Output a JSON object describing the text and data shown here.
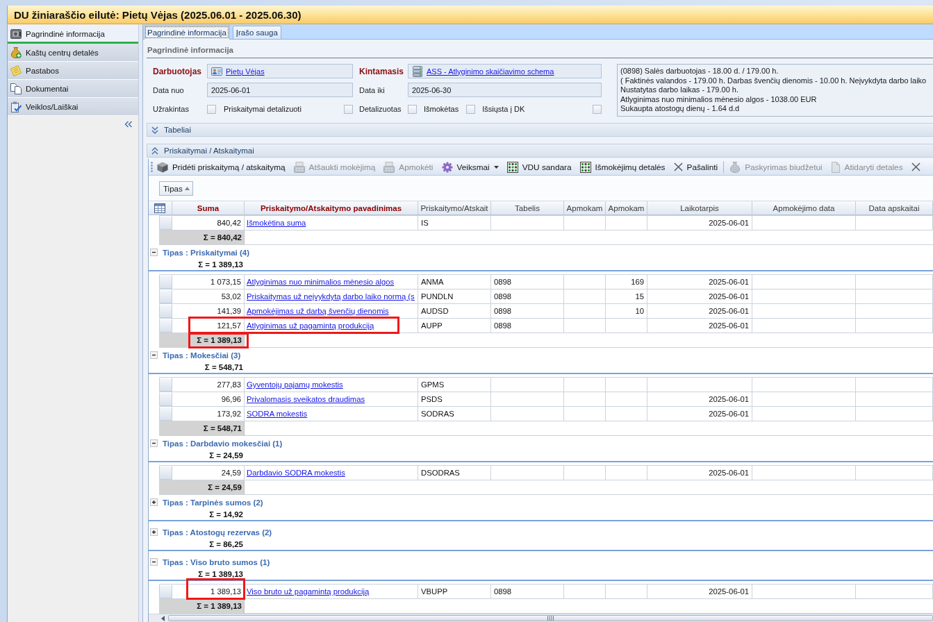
{
  "window": {
    "title": "DU žiniaraščio eilutė: Pietų Vėjas (2025.06.01 - 2025.06.30)"
  },
  "sidebar": {
    "items": [
      {
        "label": "Pagrindinė informacija",
        "selected": true
      },
      {
        "label": "Kaštų centrų detalės",
        "selected": false
      },
      {
        "label": "Pastabos",
        "selected": false
      },
      {
        "label": "Dokumentai",
        "selected": false
      },
      {
        "label": "Veiklos/Laiškai",
        "selected": false
      }
    ]
  },
  "tabs": [
    {
      "label": "Pagrindinė informacija",
      "selected": true
    },
    {
      "label": "Įrašo sauga",
      "selected": false
    }
  ],
  "general": {
    "title": "Pagrindinė informacija",
    "employee": {
      "label": "Darbuotojas",
      "required": true,
      "value": "Pietų Vėjas"
    },
    "variable": {
      "label": "Kintamasis",
      "required": true,
      "value": "ASS - Atlyginimo skaičiavimo schema"
    },
    "date_from": {
      "label": "Data nuo",
      "required": false,
      "value": "2025-06-01"
    },
    "date_to": {
      "label": "Data iki",
      "required": false,
      "value": "2025-06-30"
    },
    "flags": [
      {
        "label": "Užrakintas",
        "checked": false
      },
      {
        "label": "Priskaitymai detalizuoti",
        "checked": false
      },
      {
        "label": "Detalizuotas",
        "checked": false
      },
      {
        "label": "Išmokėtas",
        "checked": false
      },
      {
        "label": "Išsiųsta į DK",
        "checked": false
      }
    ],
    "info_lines": [
      "(0898) Salės darbuotojas - 18.00 d. / 179.00 h.",
      "( Faktinės valandos - 179.00 h. Darbas švenčių dienomis - 10.00 h. Neįvykdyta darbo laiko",
      "Nustatytas darbo laikas - 179.00 h.",
      "Atlyginimas nuo minimalios mėnesio algos - 1038.00 EUR",
      "Sukaupta atostogų dienų - 1.64 d.d"
    ]
  },
  "sections": [
    {
      "title": "Tabeliai",
      "expanded": false
    },
    {
      "title": "Priskaitymai / Atskaitymai",
      "expanded": true
    }
  ],
  "toolbar": [
    {
      "kind": "button",
      "label": "Pridėti priskaitymą / atskaitymą",
      "disabled": false
    },
    {
      "kind": "button",
      "label": "Atšaukti mokėjimą",
      "disabled": true
    },
    {
      "kind": "button",
      "label": "Apmokėti",
      "disabled": true
    },
    {
      "kind": "dropdown",
      "label": "Veiksmai",
      "disabled": false
    },
    {
      "kind": "button",
      "label": "VDU sandara",
      "disabled": false
    },
    {
      "kind": "button",
      "label": "Išmokėjimų detalės",
      "disabled": false
    },
    {
      "kind": "button",
      "label": "Pašalinti",
      "disabled": false
    },
    {
      "kind": "separator"
    },
    {
      "kind": "button",
      "label": "Paskyrimas biudžetui",
      "disabled": true
    },
    {
      "kind": "button",
      "label": "Atidaryti detales",
      "disabled": true
    },
    {
      "kind": "icon",
      "disabled": false
    }
  ],
  "grid": {
    "group_by": [
      {
        "label": "Tipas",
        "sorted_ascending": true
      }
    ],
    "columns": [
      {
        "label": "Suma",
        "required": true
      },
      {
        "label": "Priskaitymo/Atskaitymo pavadinimas",
        "required": true
      },
      {
        "label": "Priskaitymo/Atskait",
        "required": false
      },
      {
        "label": "Tabelis",
        "required": false
      },
      {
        "label": "Apmokam",
        "required": false
      },
      {
        "label": "Apmokam",
        "required": false
      },
      {
        "label": "Laikotarpis",
        "required": false
      },
      {
        "label": "Apmokėjimo data",
        "required": false
      },
      {
        "label": "Data apskaitai",
        "required": false
      }
    ],
    "groups": [
      {
        "rows": [
          {
            "cells": [
              "840,42",
              "Išmokėtina suma",
              "IS",
              null,
              null,
              null,
              "2025-06-01"
            ],
            "frame_amount": false,
            "frame_name": false
          }
        ],
        "footer": {
          "sum": "Σ = 840,42",
          "highlighted": false
        }
      },
      {
        "title": "Tipas : Priskaitymai (4)",
        "expanded": true,
        "total": "Σ = 1 389,13",
        "rows": [
          {
            "cells": [
              "1 073,15",
              "Atlyginimas nuo minimalios mėnesio algos",
              "ANMA",
              "0898",
              null,
              "169",
              "2025-06-01"
            ],
            "frame_amount": false,
            "frame_name": false
          },
          {
            "cells": [
              "53,02",
              "Priskaitymas už neįvykdytą darbo laiko normą (s",
              "PUNDLN",
              "0898",
              null,
              "15",
              "2025-06-01"
            ],
            "frame_amount": false,
            "frame_name": false
          },
          {
            "cells": [
              "141,39",
              "Apmokėjimas už darbą švenčių dienomis",
              "AUDSD",
              "0898",
              null,
              "10",
              "2025-06-01"
            ],
            "frame_amount": false,
            "frame_name": false
          },
          {
            "cells": [
              "121,57",
              "Atlyginimas už pagamintą produkciją",
              "AUPP",
              "0898",
              null,
              null,
              "2025-06-01"
            ],
            "frame_amount": true,
            "frame_name": true
          }
        ],
        "footer": {
          "sum": "Σ = 1 389,13",
          "highlighted": true
        }
      },
      {
        "title": "Tipas : Mokesčiai (3)",
        "expanded": true,
        "total": "Σ = 548,71",
        "rows": [
          {
            "cells": [
              "277,83",
              "Gyventojų pajamų mokestis",
              "GPMS"
            ],
            "frame_amount": false,
            "frame_name": false
          },
          {
            "cells": [
              "96,96",
              "Privalomasis sveikatos draudimas",
              "PSDS",
              null,
              null,
              null,
              "2025-06-01"
            ],
            "frame_amount": false,
            "frame_name": false
          },
          {
            "cells": [
              "173,92",
              "SODRA mokestis",
              "SODRAS",
              null,
              null,
              null,
              "2025-06-01"
            ],
            "frame_amount": false,
            "frame_name": false
          }
        ],
        "footer": {
          "sum": "Σ = 548,71",
          "highlighted": false
        }
      },
      {
        "title": "Tipas : Darbdavio mokesčiai (1)",
        "expanded": true,
        "total": "Σ = 24,59",
        "rows": [
          {
            "cells": [
              "24,59",
              "Darbdavio SODRA mokestis",
              "DSODRAS",
              null,
              null,
              null,
              "2025-06-01"
            ],
            "frame_amount": false,
            "frame_name": false
          }
        ],
        "footer": {
          "sum": "Σ = 24,59",
          "highlighted": false
        }
      },
      {
        "title": "Tipas : Tarpinės sumos (2)",
        "expanded": false,
        "total": "Σ = 14,92"
      },
      {
        "title": "Tipas : Atostogų rezervas (2)",
        "expanded": false,
        "total": "Σ = 86,25"
      },
      {
        "title": "Tipas : Viso bruto sumos (1)",
        "expanded": true,
        "total": "Σ = 1 389,13",
        "rows": [
          {
            "cells": [
              "1 389,13",
              "Viso bruto už pagamintą produkciją",
              "VBUPP",
              "0898",
              null,
              null,
              "2025-06-01"
            ],
            "frame_amount": true,
            "frame_name": false
          }
        ],
        "footer": {
          "sum": "Σ = 1 389,13",
          "highlighted": false
        }
      }
    ]
  }
}
